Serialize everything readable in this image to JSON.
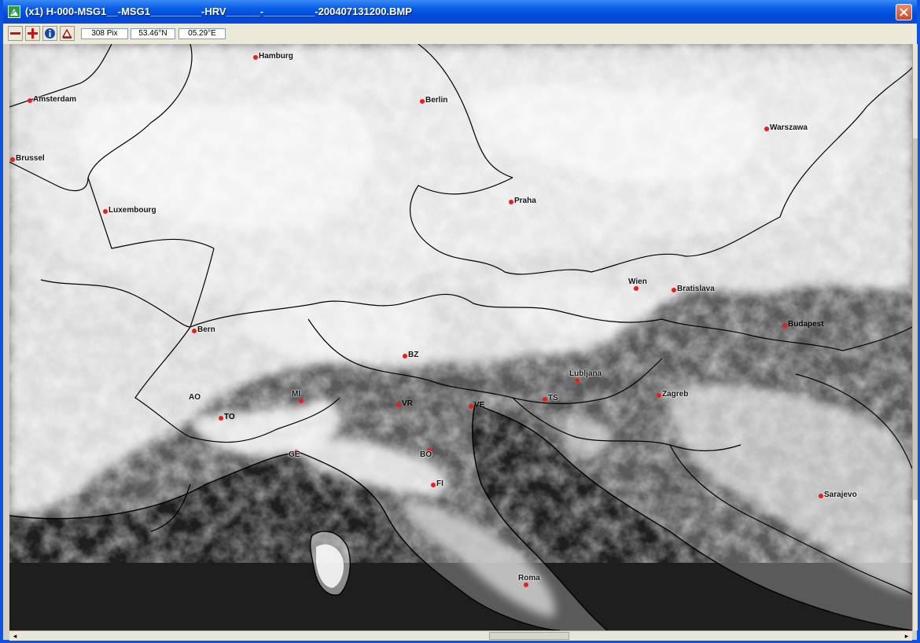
{
  "window": {
    "title": "(x1) H-000-MSG1__-MSG1_________-HRV______-_________-200407131200.BMP"
  },
  "toolbar": {
    "buttons": [
      {
        "name": "zoom-out-button",
        "icon": "minus-icon"
      },
      {
        "name": "zoom-in-button",
        "icon": "plus-icon"
      },
      {
        "name": "info-button",
        "icon": "info-icon"
      },
      {
        "name": "tool-button",
        "icon": "eraser-icon"
      }
    ],
    "pixel_readout": "308 Pix",
    "latitude_readout": "53.46°N",
    "longitude_readout": "05.29°E"
  },
  "map": {
    "cities": [
      {
        "name": "Hamburg"
      },
      {
        "name": "Amsterdam"
      },
      {
        "name": "Berlin"
      },
      {
        "name": "Warszawa"
      },
      {
        "name": "Brussel"
      },
      {
        "name": "Luxembourg"
      },
      {
        "name": "Praha"
      },
      {
        "name": "Wien"
      },
      {
        "name": "Bratislava"
      },
      {
        "name": "Budapest"
      },
      {
        "name": "Bern"
      },
      {
        "name": "BZ"
      },
      {
        "name": "Lubljana"
      },
      {
        "name": "AO"
      },
      {
        "name": "MI"
      },
      {
        "name": "VR"
      },
      {
        "name": "VE"
      },
      {
        "name": "TS"
      },
      {
        "name": "Zagreb"
      },
      {
        "name": "TO"
      },
      {
        "name": "GE"
      },
      {
        "name": "BO"
      },
      {
        "name": "FI"
      },
      {
        "name": "Sarajevo"
      },
      {
        "name": "Roma"
      }
    ]
  },
  "colors": {
    "title_bar": "#0047d6",
    "marker": "#e61e1e",
    "sea": "#1e1e1e",
    "land": "#5a5a5a",
    "cloud": "#f4f4f4"
  }
}
